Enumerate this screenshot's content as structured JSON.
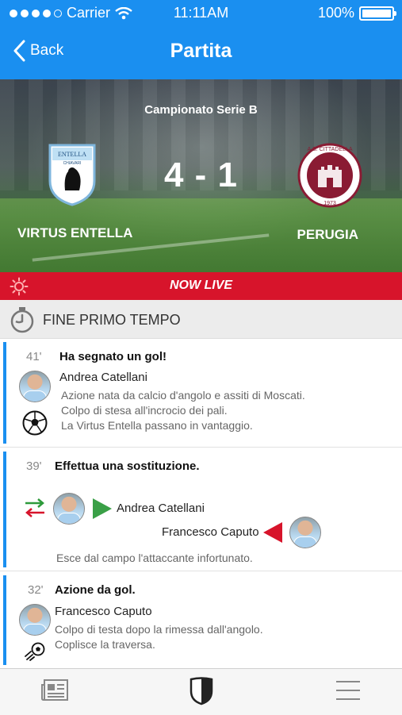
{
  "status": {
    "carrier": "Carrier",
    "time": "11:11AM",
    "battery": "100%"
  },
  "nav": {
    "back_label": "Back",
    "title": "Partita"
  },
  "match": {
    "league": "Campionato Serie B",
    "score": "4 - 1",
    "home_team": "VIRTUS ENTELLA",
    "away_team": "PERUGIA"
  },
  "live": {
    "label": "NOW LIVE"
  },
  "section": {
    "label": "FINE PRIMO TEMPO"
  },
  "events": [
    {
      "minute": "41'",
      "title": "Ha segnato un gol!",
      "player": "Andrea Catellani",
      "description": [
        "Azione nata da calcio d'angolo e assiti di Moscati.",
        "Colpo di stesa all'incrocio dei pali.",
        "La Virtus Entella passano in vantaggio."
      ]
    },
    {
      "minute": "39'",
      "title": "Effettua una sostituzione.",
      "player_in": "Andrea Catellani",
      "player_out": "Francesco Caputo",
      "description": "Esce dal campo l'attaccante infortunato."
    },
    {
      "minute": "32'",
      "title": "Azione da gol.",
      "player": "Francesco Caputo",
      "description": [
        "Colpo di testa dopo la rimessa dall'angolo.",
        "Coplisce la traversa."
      ]
    }
  ],
  "tabbar": {
    "items": [
      "news-icon",
      "shield-icon",
      "menu-icon"
    ]
  },
  "colors": {
    "accent": "#1a8ff0",
    "live": "#d7142b"
  }
}
